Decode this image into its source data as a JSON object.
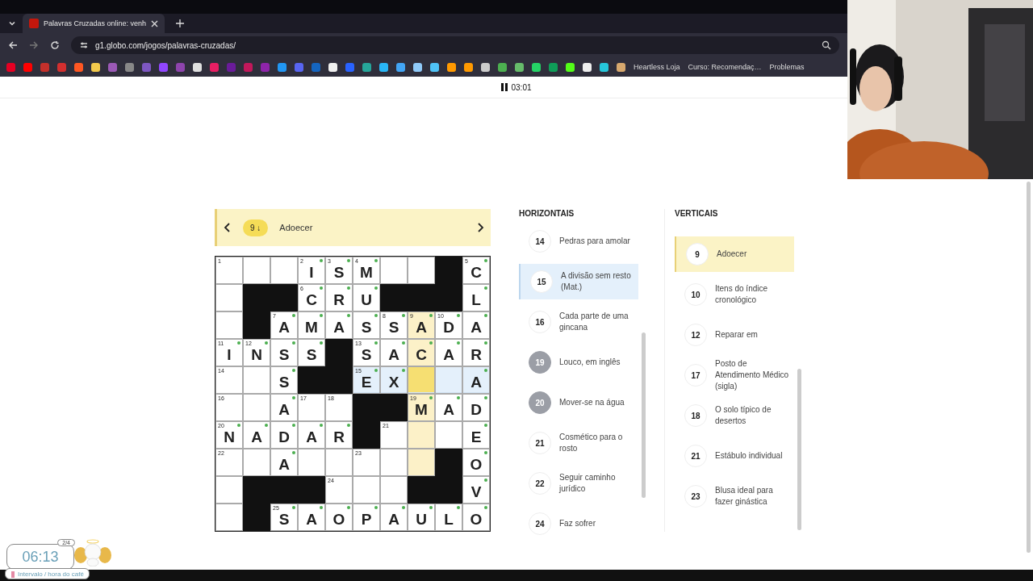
{
  "browser": {
    "tab_title": "Palavras Cruzadas online: venh",
    "url": "g1.globo.com/jogos/palavras-cruzadas/",
    "bookmarks": [
      "Heartless Loja",
      "Curso: Recomendaç…",
      "Problemas"
    ]
  },
  "timer": "03:01",
  "clue_bar": {
    "number": "9",
    "direction": "↓",
    "text": "Adoecer"
  },
  "grid": {
    "rows": [
      [
        {
          "kind": "cell",
          "number": "1",
          "checked": false,
          "in_clue": false,
          "in_cross": false,
          "current": false
        },
        {
          "kind": "cell",
          "checked": false,
          "in_clue": false,
          "in_cross": false,
          "current": false
        },
        {
          "kind": "cell",
          "checked": false,
          "in_clue": false,
          "in_cross": false,
          "current": false
        },
        {
          "kind": "cell",
          "number": "2",
          "letter": "I",
          "checked": true,
          "in_clue": false,
          "in_cross": false,
          "current": false
        },
        {
          "kind": "cell",
          "number": "3",
          "letter": "S",
          "checked": true,
          "in_clue": false,
          "in_cross": false,
          "current": false
        },
        {
          "kind": "cell",
          "number": "4",
          "letter": "M",
          "checked": true,
          "in_clue": false,
          "in_cross": false,
          "current": false
        },
        {
          "kind": "cell",
          "checked": false,
          "in_clue": false,
          "in_cross": false,
          "current": false
        },
        {
          "kind": "cell",
          "checked": false,
          "in_clue": false,
          "in_cross": false,
          "current": false
        },
        {
          "kind": "block"
        },
        {
          "kind": "cell",
          "number": "5",
          "letter": "C",
          "checked": true,
          "in_clue": false,
          "in_cross": false,
          "current": false
        }
      ],
      [
        {
          "kind": "cell",
          "checked": false,
          "in_clue": false,
          "in_cross": false,
          "current": false
        },
        {
          "kind": "block"
        },
        {
          "kind": "block"
        },
        {
          "kind": "cell",
          "number": "6",
          "letter": "C",
          "checked": true,
          "in_clue": false,
          "in_cross": false,
          "current": false
        },
        {
          "kind": "cell",
          "letter": "R",
          "checked": true,
          "in_clue": false,
          "in_cross": false,
          "current": false
        },
        {
          "kind": "cell",
          "letter": "U",
          "checked": true,
          "in_clue": false,
          "in_cross": false,
          "current": false
        },
        {
          "kind": "block"
        },
        {
          "kind": "block"
        },
        {
          "kind": "block"
        },
        {
          "kind": "cell",
          "letter": "L",
          "checked": true,
          "in_clue": false,
          "in_cross": false,
          "current": false
        }
      ],
      [
        {
          "kind": "cell",
          "checked": false,
          "in_clue": false,
          "in_cross": false,
          "current": false
        },
        {
          "kind": "block"
        },
        {
          "kind": "cell",
          "number": "7",
          "letter": "A",
          "checked": true,
          "in_clue": false,
          "in_cross": false,
          "current": false
        },
        {
          "kind": "cell",
          "letter": "M",
          "checked": true,
          "in_clue": false,
          "in_cross": false,
          "current": false
        },
        {
          "kind": "cell",
          "letter": "A",
          "checked": true,
          "in_clue": false,
          "in_cross": false,
          "current": false
        },
        {
          "kind": "cell",
          "letter": "S",
          "checked": true,
          "in_clue": false,
          "in_cross": false,
          "current": false
        },
        {
          "kind": "cell",
          "number": "8",
          "letter": "S",
          "checked": true,
          "in_clue": false,
          "in_cross": false,
          "current": false
        },
        {
          "kind": "cell",
          "number": "9",
          "letter": "A",
          "checked": true,
          "in_clue": true,
          "in_cross": false,
          "current": false
        },
        {
          "kind": "cell",
          "number": "10",
          "letter": "D",
          "checked": true,
          "in_clue": false,
          "in_cross": false,
          "current": false
        },
        {
          "kind": "cell",
          "letter": "A",
          "checked": true,
          "in_clue": false,
          "in_cross": false,
          "current": false
        }
      ],
      [
        {
          "kind": "cell",
          "number": "11",
          "letter": "I",
          "checked": true,
          "in_clue": false,
          "in_cross": false,
          "current": false
        },
        {
          "kind": "cell",
          "number": "12",
          "letter": "N",
          "checked": true,
          "in_clue": false,
          "in_cross": false,
          "current": false
        },
        {
          "kind": "cell",
          "letter": "S",
          "checked": true,
          "in_clue": false,
          "in_cross": false,
          "current": false
        },
        {
          "kind": "cell",
          "letter": "S",
          "checked": true,
          "in_clue": false,
          "in_cross": false,
          "current": false
        },
        {
          "kind": "block"
        },
        {
          "kind": "cell",
          "number": "13",
          "letter": "S",
          "checked": true,
          "in_clue": false,
          "in_cross": false,
          "current": false
        },
        {
          "kind": "cell",
          "letter": "A",
          "checked": true,
          "in_clue": false,
          "in_cross": false,
          "current": false
        },
        {
          "kind": "cell",
          "letter": "C",
          "checked": true,
          "in_clue": true,
          "in_cross": false,
          "current": false
        },
        {
          "kind": "cell",
          "letter": "A",
          "checked": true,
          "in_clue": false,
          "in_cross": false,
          "current": false
        },
        {
          "kind": "cell",
          "letter": "R",
          "checked": true,
          "in_clue": false,
          "in_cross": false,
          "current": false
        }
      ],
      [
        {
          "kind": "cell",
          "number": "14",
          "checked": false,
          "in_clue": false,
          "in_cross": false,
          "current": false
        },
        {
          "kind": "cell",
          "checked": false,
          "in_clue": false,
          "in_cross": false,
          "current": false
        },
        {
          "kind": "cell",
          "letter": "S",
          "checked": true,
          "in_clue": false,
          "in_cross": false,
          "current": false
        },
        {
          "kind": "block"
        },
        {
          "kind": "block"
        },
        {
          "kind": "cell",
          "number": "15",
          "letter": "E",
          "checked": true,
          "in_clue": false,
          "in_cross": true,
          "current": false
        },
        {
          "kind": "cell",
          "letter": "X",
          "checked": true,
          "in_clue": false,
          "in_cross": true,
          "current": false
        },
        {
          "kind": "cell",
          "checked": false,
          "in_clue": true,
          "in_cross": true,
          "current": true
        },
        {
          "kind": "cell",
          "checked": false,
          "in_clue": false,
          "in_cross": true,
          "current": false
        },
        {
          "kind": "cell",
          "letter": "A",
          "checked": true,
          "in_clue": false,
          "in_cross": true,
          "current": false
        }
      ],
      [
        {
          "kind": "cell",
          "number": "16",
          "checked": false,
          "in_clue": false,
          "in_cross": false,
          "current": false
        },
        {
          "kind": "cell",
          "checked": false,
          "in_clue": false,
          "in_cross": false,
          "current": false
        },
        {
          "kind": "cell",
          "letter": "A",
          "checked": true,
          "in_clue": false,
          "in_cross": false,
          "current": false
        },
        {
          "kind": "cell",
          "number": "17",
          "checked": false,
          "in_clue": false,
          "in_cross": false,
          "current": false
        },
        {
          "kind": "cell",
          "number": "18",
          "checked": false,
          "in_clue": false,
          "in_cross": false,
          "current": false
        },
        {
          "kind": "block"
        },
        {
          "kind": "block"
        },
        {
          "kind": "cell",
          "number": "19",
          "letter": "M",
          "checked": true,
          "in_clue": true,
          "in_cross": false,
          "current": false
        },
        {
          "kind": "cell",
          "letter": "A",
          "checked": true,
          "in_clue": false,
          "in_cross": false,
          "current": false
        },
        {
          "kind": "cell",
          "letter": "D",
          "checked": true,
          "in_clue": false,
          "in_cross": false,
          "current": false
        }
      ],
      [
        {
          "kind": "cell",
          "number": "20",
          "letter": "N",
          "checked": true,
          "in_clue": false,
          "in_cross": false,
          "current": false
        },
        {
          "kind": "cell",
          "letter": "A",
          "checked": true,
          "in_clue": false,
          "in_cross": false,
          "current": false
        },
        {
          "kind": "cell",
          "letter": "D",
          "checked": true,
          "in_clue": false,
          "in_cross": false,
          "current": false
        },
        {
          "kind": "cell",
          "letter": "A",
          "checked": true,
          "in_clue": false,
          "in_cross": false,
          "current": false
        },
        {
          "kind": "cell",
          "letter": "R",
          "checked": true,
          "in_clue": false,
          "in_cross": false,
          "current": false
        },
        {
          "kind": "block"
        },
        {
          "kind": "cell",
          "number": "21",
          "checked": false,
          "in_clue": false,
          "in_cross": false,
          "current": false
        },
        {
          "kind": "cell",
          "checked": false,
          "in_clue": true,
          "in_cross": false,
          "current": false
        },
        {
          "kind": "cell",
          "checked": false,
          "in_clue": false,
          "in_cross": false,
          "current": false
        },
        {
          "kind": "cell",
          "letter": "E",
          "checked": true,
          "in_clue": false,
          "in_cross": false,
          "current": false
        }
      ],
      [
        {
          "kind": "cell",
          "number": "22",
          "checked": false,
          "in_clue": false,
          "in_cross": false,
          "current": false
        },
        {
          "kind": "cell",
          "checked": false,
          "in_clue": false,
          "in_cross": false,
          "current": false
        },
        {
          "kind": "cell",
          "letter": "A",
          "checked": true,
          "in_clue": false,
          "in_cross": false,
          "current": false
        },
        {
          "kind": "cell",
          "checked": false,
          "in_clue": false,
          "in_cross": false,
          "current": false
        },
        {
          "kind": "cell",
          "checked": false,
          "in_clue": false,
          "in_cross": false,
          "current": false
        },
        {
          "kind": "cell",
          "number": "23",
          "checked": false,
          "in_clue": false,
          "in_cross": false,
          "current": false
        },
        {
          "kind": "cell",
          "checked": false,
          "in_clue": false,
          "in_cross": false,
          "current": false
        },
        {
          "kind": "cell",
          "checked": false,
          "in_clue": true,
          "in_cross": false,
          "current": false
        },
        {
          "kind": "block"
        },
        {
          "kind": "cell",
          "letter": "O",
          "checked": true,
          "in_clue": false,
          "in_cross": false,
          "current": false
        }
      ],
      [
        {
          "kind": "cell",
          "checked": false,
          "in_clue": false,
          "in_cross": false,
          "current": false
        },
        {
          "kind": "block"
        },
        {
          "kind": "block"
        },
        {
          "kind": "block"
        },
        {
          "kind": "cell",
          "number": "24",
          "checked": false,
          "in_clue": false,
          "in_cross": false,
          "current": false
        },
        {
          "kind": "cell",
          "checked": false,
          "in_clue": false,
          "in_cross": false,
          "current": false
        },
        {
          "kind": "cell",
          "checked": false,
          "in_clue": false,
          "in_cross": false,
          "current": false
        },
        {
          "kind": "block"
        },
        {
          "kind": "block"
        },
        {
          "kind": "cell",
          "letter": "V",
          "checked": true,
          "in_clue": false,
          "in_cross": false,
          "current": false
        }
      ],
      [
        {
          "kind": "cell",
          "checked": false,
          "in_clue": false,
          "in_cross": false,
          "current": false
        },
        {
          "kind": "block"
        },
        {
          "kind": "cell",
          "number": "25",
          "letter": "S",
          "checked": true,
          "in_clue": false,
          "in_cross": false,
          "current": false
        },
        {
          "kind": "cell",
          "letter": "A",
          "checked": true,
          "in_clue": false,
          "in_cross": false,
          "current": false
        },
        {
          "kind": "cell",
          "letter": "O",
          "checked": true,
          "in_clue": false,
          "in_cross": false,
          "current": false
        },
        {
          "kind": "cell",
          "letter": "P",
          "checked": true,
          "in_clue": false,
          "in_cross": false,
          "current": false
        },
        {
          "kind": "cell",
          "letter": "A",
          "checked": true,
          "in_clue": false,
          "in_cross": false,
          "current": false
        },
        {
          "kind": "cell",
          "letter": "U",
          "checked": true,
          "in_clue": false,
          "in_cross": false,
          "current": false
        },
        {
          "kind": "cell",
          "letter": "L",
          "checked": true,
          "in_clue": false,
          "in_cross": false,
          "current": false
        },
        {
          "kind": "cell",
          "letter": "O",
          "checked": true,
          "in_clue": false,
          "in_cross": false,
          "current": false
        }
      ]
    ]
  },
  "horizontais": {
    "title": "HORIZONTAIS",
    "items": [
      {
        "number": "14",
        "text": "Pedras para amolar",
        "selected": false,
        "solved": false
      },
      {
        "number": "15",
        "text": "A divisão sem resto (Mat.)",
        "selected": true,
        "solved": false
      },
      {
        "number": "16",
        "text": "Cada parte de uma gincana",
        "selected": false,
        "solved": false
      },
      {
        "number": "19",
        "text": "Louco, em inglês",
        "selected": false,
        "solved": true
      },
      {
        "number": "20",
        "text": "Mover-se na água",
        "selected": false,
        "solved": true
      },
      {
        "number": "21",
        "text": "Cosmético para o rosto",
        "selected": false,
        "solved": false
      },
      {
        "number": "22",
        "text": "Seguir caminho jurídico",
        "selected": false,
        "solved": false
      },
      {
        "number": "24",
        "text": "Faz sofrer",
        "selected": false,
        "solved": false
      }
    ]
  },
  "verticais": {
    "title": "VERTICAIS",
    "items": [
      {
        "number": "9",
        "text": "Adoecer",
        "selected": true,
        "solved": false
      },
      {
        "number": "10",
        "text": "Itens do índice cronológico",
        "selected": false,
        "solved": false
      },
      {
        "number": "12",
        "text": "Reparar em",
        "selected": false,
        "solved": false
      },
      {
        "number": "17",
        "text": "Posto de Atendimento Médico (sigla)",
        "selected": false,
        "solved": false
      },
      {
        "number": "18",
        "text": "O solo típico de desertos",
        "selected": false,
        "solved": false
      },
      {
        "number": "21",
        "text": "Estábulo individual",
        "selected": false,
        "solved": false
      },
      {
        "number": "23",
        "text": "Blusa ideal para fazer ginástica",
        "selected": false,
        "solved": false
      }
    ]
  },
  "overlay": {
    "session": "2/4",
    "time": "06:13",
    "caption": "Intervalo / hora do café"
  }
}
